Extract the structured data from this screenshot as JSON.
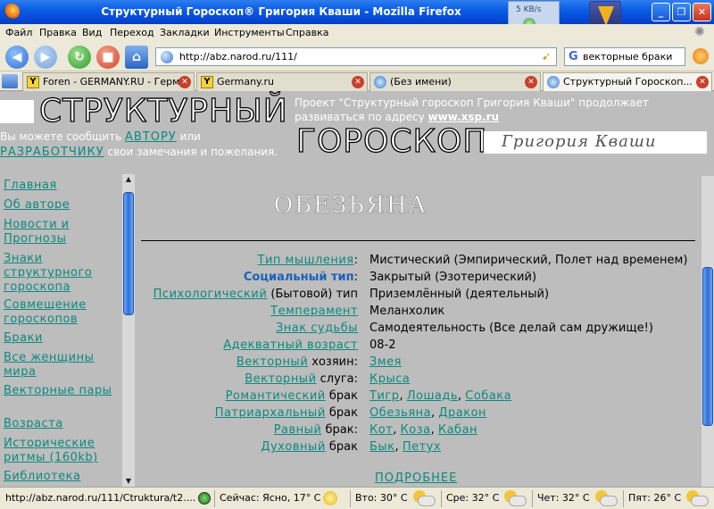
{
  "window": {
    "title": "Структурный Гороскоп® Григория Кваши - Mozilla Firefox",
    "download_speed": "5 KB/s"
  },
  "menu": [
    "Файл",
    "Правка",
    "Вид",
    "Переход",
    "Закладки",
    "Инструменты",
    "Справка"
  ],
  "nav": {
    "url": "http://abz.narod.ru/111/",
    "search_value": "векторные браки"
  },
  "tabs": [
    {
      "label": "Foren - GERMANY.RU - Герм..."
    },
    {
      "label": "Germany.ru"
    },
    {
      "label": "(Без имени)"
    },
    {
      "label": "Структурный Гороскоп..."
    }
  ],
  "header": {
    "logo_line1": "СТРУКТУРНЫЙ",
    "logo_line2": "ГОРОСКОП",
    "signature": "Григория Кваши",
    "project_text": "Проект \"Структурный гороскоп Григория Кваши\" продолжает развиваться по адресу",
    "project_link": "www.xsp.ru",
    "contact_prefix": "Вы можете сообщить",
    "contact_author": "АВТОРУ",
    "contact_or": "или",
    "contact_dev": "РАЗРАБОТЧИКУ",
    "contact_suffix": "свои замечания и пожелания."
  },
  "sidebar": {
    "items": [
      {
        "label": "Главная"
      },
      {
        "label": "Об авторе"
      },
      {
        "label": "Новости и Прогнозы"
      },
      {
        "label": "Знаки структурного гороскопа"
      },
      {
        "label": "Совмещение гороскопов"
      },
      {
        "label": "Браки"
      },
      {
        "label": "Все женщины мира"
      },
      {
        "label": "Векторные пары"
      },
      {
        "label": "Возраста"
      },
      {
        "label": "Исторические ритмы (160kb)"
      },
      {
        "label": "Библиотека"
      }
    ]
  },
  "main": {
    "heading": "ОБЕЗЬЯНА",
    "rows": [
      {
        "label_link": "Тип мышления",
        "label_text": ":",
        "value": "Мистический (Эмпирический, Полет над временем)"
      },
      {
        "label_link": "Социальный тип",
        "label_text": ":",
        "value": "Закрытый (Эзотерический)"
      },
      {
        "label_link": "Психологический",
        "label_text": " (Бытовой) тип",
        "value": "Приземлённый (деятельный)"
      },
      {
        "label_link": "Темперамент",
        "label_text": "",
        "value": "Меланхолик"
      },
      {
        "label_link": "Знак судьбы",
        "label_text": "",
        "value": "Самодеятельность (Все делай сам дружище!)"
      },
      {
        "label_link": "Адекватный возраст",
        "label_text": "",
        "value": "08-2"
      },
      {
        "label_link": "Векторный",
        "label_text": " хозяин:",
        "value_links": [
          "Змея"
        ]
      },
      {
        "label_link": "Векторный",
        "label_text": " слуга:",
        "value_links": [
          "Крыса"
        ]
      },
      {
        "label_link": "Романтический",
        "label_text": " брак",
        "value_links": [
          "Тигр",
          "Лошадь",
          "Собака"
        ]
      },
      {
        "label_link": "Патриархальный",
        "label_text": " брак",
        "value_links": [
          "Обезьяна",
          "Дракон"
        ]
      },
      {
        "label_link": "Равный",
        "label_text": " брак:",
        "value_links": [
          "Кот",
          "Коза",
          "Кабан"
        ]
      },
      {
        "label_link": "Духовный",
        "label_text": " брак",
        "value_links": [
          "Бык",
          "Петух"
        ]
      }
    ],
    "more_link": "ПОДРОБНЕЕ"
  },
  "status": {
    "url": "http://abz.narod.ru/111/Ctruktura/t2....",
    "now": "Сейчас: Ясно, 17° C",
    "tue": "Вто: 30° C",
    "wed": "Сре: 32° C",
    "thu": "Чет: 32° C",
    "fri": "Пят: 26° C"
  },
  "colors": {
    "page_bg": "#bdbdbd",
    "link": "#0a8a7e",
    "social_link": "#1b62b8",
    "titlebar": "#0a5de6"
  }
}
